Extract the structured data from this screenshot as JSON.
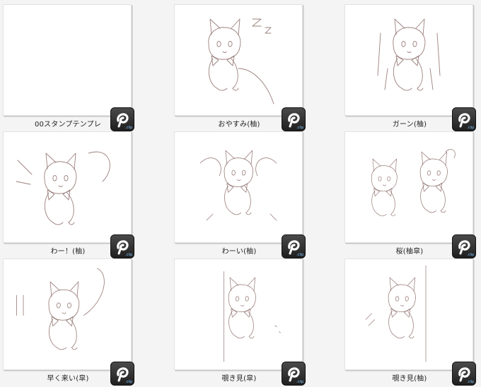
{
  "items": [
    {
      "label": "00スタンプテンプレ",
      "sketch": "blank"
    },
    {
      "label": "おやすみ(柚)",
      "sketch": "sleep"
    },
    {
      "label": "ガーン(柚)",
      "sketch": "shock"
    },
    {
      "label": "わー！(柚)",
      "sketch": "wah"
    },
    {
      "label": "わーい(柚)",
      "sketch": "yay"
    },
    {
      "label": "桜(柚皐)",
      "sketch": "pair"
    },
    {
      "label": "早く来い(皐)",
      "sketch": "hurry"
    },
    {
      "label": "覗き見(皐)",
      "sketch": "peek"
    },
    {
      "label": "覗き見(柚)",
      "sketch": "peek2"
    }
  ],
  "badge": {
    "icon": "clip-studio-file-icon"
  },
  "colors": {
    "sketch_line": "#8a6a66",
    "badge_bg": "#2b2b2b"
  }
}
